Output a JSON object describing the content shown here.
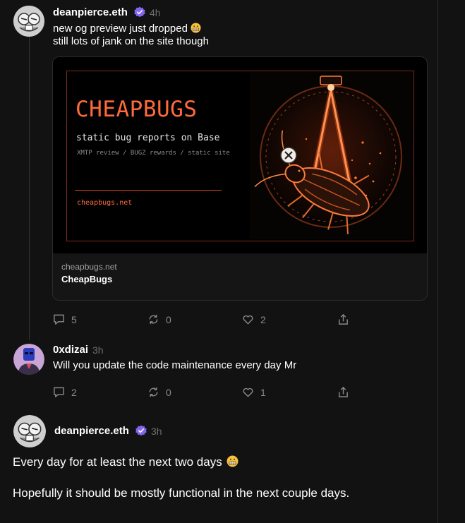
{
  "colors": {
    "background": "#121212",
    "verified": "#8465ef",
    "accent_orange": "#ff6a3c",
    "muted_text": "#6e6e6e"
  },
  "posts": [
    {
      "username": "deanpierce.eth",
      "verified": true,
      "timestamp": "4h",
      "lines": [
        "new og preview just dropped",
        "still lots of jank on the site though"
      ],
      "emoji": "grimacing-face",
      "embed": {
        "og_title": "CHEAPBUGS",
        "og_subtitle": "static bug reports on Base",
        "og_tagline": "XMTP review / BUGZ rewards / static site",
        "og_url": "cheapbugs.net",
        "domain": "cheapbugs.net",
        "title": "CheapBugs"
      },
      "actions": {
        "replies": "5",
        "recasts": "0",
        "likes": "2"
      }
    },
    {
      "username": "0xdizai",
      "verified": false,
      "timestamp": "3h",
      "lines": [
        "Will you update the code maintenance every day Mr"
      ],
      "actions": {
        "replies": "2",
        "recasts": "0",
        "likes": "1"
      }
    },
    {
      "username": "deanpierce.eth",
      "verified": true,
      "timestamp": "3h",
      "paragraphs": [
        "Every day for at least the next two days",
        "Hopefully it should be mostly functional in the next couple days."
      ],
      "emoji": "grimacing-face"
    }
  ]
}
